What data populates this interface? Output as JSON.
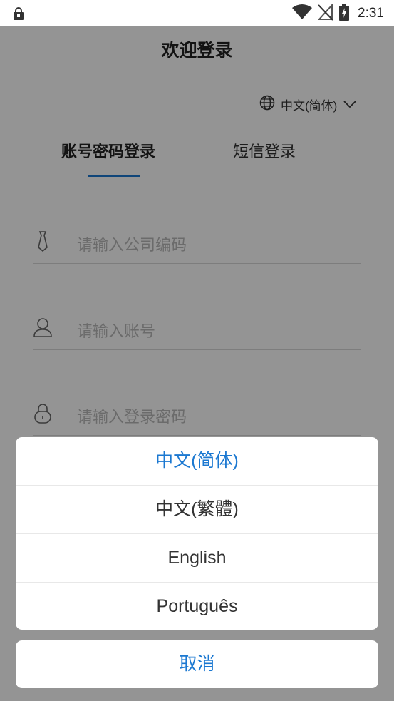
{
  "status_bar": {
    "time": "2:31"
  },
  "header": {
    "title": "欢迎登录"
  },
  "language_selector": {
    "current": "中文(简体)"
  },
  "tabs": [
    {
      "label": "账号密码登录",
      "active": true
    },
    {
      "label": "短信登录",
      "active": false
    }
  ],
  "fields": {
    "company_code": {
      "placeholder": "请输入公司编码"
    },
    "account": {
      "placeholder": "请输入账号"
    },
    "password": {
      "placeholder": "请输入登录密码"
    }
  },
  "language_sheet": {
    "options": [
      {
        "label": "中文(简体)",
        "selected": true
      },
      {
        "label": "中文(繁體)",
        "selected": false
      },
      {
        "label": "English",
        "selected": false
      },
      {
        "label": "Português",
        "selected": false
      }
    ],
    "cancel_label": "取消"
  },
  "colors": {
    "accent": "#1b78d1",
    "overlay": "rgba(0,0,0,0.42)"
  }
}
